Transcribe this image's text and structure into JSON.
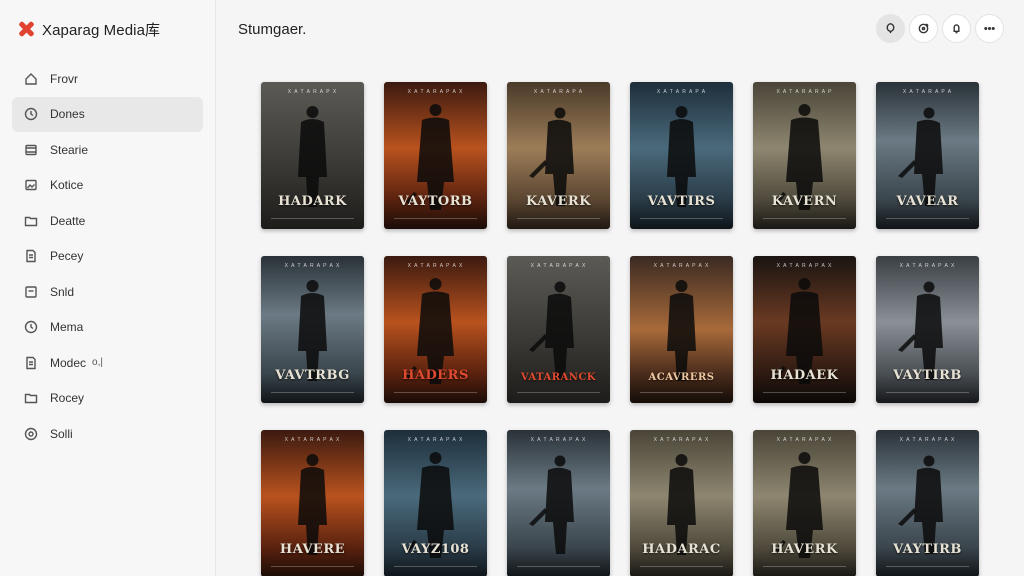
{
  "app": {
    "title": "Xaparag Media库",
    "accent": "#e0432f"
  },
  "sidebar": {
    "items": [
      {
        "label": "Frovr",
        "icon": "home-icon",
        "active": false
      },
      {
        "label": "Dones",
        "icon": "clock-icon",
        "active": true
      },
      {
        "label": "Stearie",
        "icon": "film-icon",
        "active": false
      },
      {
        "label": "Kotice",
        "icon": "photo-icon",
        "active": false
      },
      {
        "label": "Deatte",
        "icon": "folder-icon",
        "active": false
      },
      {
        "label": "Pecey",
        "icon": "document-icon",
        "active": false
      },
      {
        "label": "Snld",
        "icon": "grid-icon",
        "active": false
      },
      {
        "label": "Mema",
        "icon": "clock-icon",
        "active": false
      },
      {
        "label": "Modec",
        "icon": "document-icon",
        "badge": "о,|",
        "active": false
      },
      {
        "label": "Rocey",
        "icon": "folder-icon",
        "active": false
      },
      {
        "label": "Solli",
        "icon": "settings-icon",
        "active": false
      }
    ]
  },
  "main": {
    "title": "Stumgaer.",
    "toolbar": [
      {
        "icon": "search-icon",
        "active": true
      },
      {
        "icon": "refresh-icon",
        "active": false
      },
      {
        "icon": "bell-icon",
        "active": false
      },
      {
        "icon": "more-icon",
        "active": false
      }
    ],
    "posters": [
      {
        "title": "HADARK",
        "tagline": "X A T A R A P X",
        "bg": "grey"
      },
      {
        "title": "VAYTORB",
        "tagline": "X A T A R A P A X",
        "bg": "orange"
      },
      {
        "title": "KAVERK",
        "tagline": "X A T A R A P A",
        "bg": "tan"
      },
      {
        "title": "VAVTIRS",
        "tagline": "X A T A R A P A",
        "bg": "blue"
      },
      {
        "title": "KAVERN",
        "tagline": "X A T A R A R A P",
        "bg": "sand"
      },
      {
        "title": "VAVEAR",
        "tagline": "X A T A R A P A",
        "bg": "steel"
      },
      {
        "title": "VAVTRBG",
        "tagline": "X A T A R A P A X",
        "bg": "steel"
      },
      {
        "title": "HADERS",
        "tagline": "X A T A R A P A X",
        "bg": "orange"
      },
      {
        "title": "VATARANCK",
        "tagline": "X A T A R A P A X",
        "bg": "grey"
      },
      {
        "title": "ACAVRERS",
        "tagline": "X A T A R A P A X",
        "bg": "dusk"
      },
      {
        "title": "HADAEK",
        "tagline": "X A T A R A P A X",
        "bg": "ember"
      },
      {
        "title": "VAYTIRB",
        "tagline": "X A T A R A P A X",
        "bg": "slate"
      },
      {
        "title": "HAVERE",
        "tagline": "X A T A R A P A X",
        "bg": "orange"
      },
      {
        "title": "VAYZ108",
        "tagline": "X A T A R A P A X",
        "bg": "blue"
      },
      {
        "title": "",
        "tagline": "X A T A R A P A X",
        "bg": "steel"
      },
      {
        "title": "HADARAC",
        "tagline": "X A T A R A P A X",
        "bg": "sand"
      },
      {
        "title": "HAVERK",
        "tagline": "X A T A R A P A X",
        "bg": "sand"
      },
      {
        "title": "VAYTIRB",
        "tagline": "X A T A R A P A X",
        "bg": "steel"
      }
    ]
  }
}
